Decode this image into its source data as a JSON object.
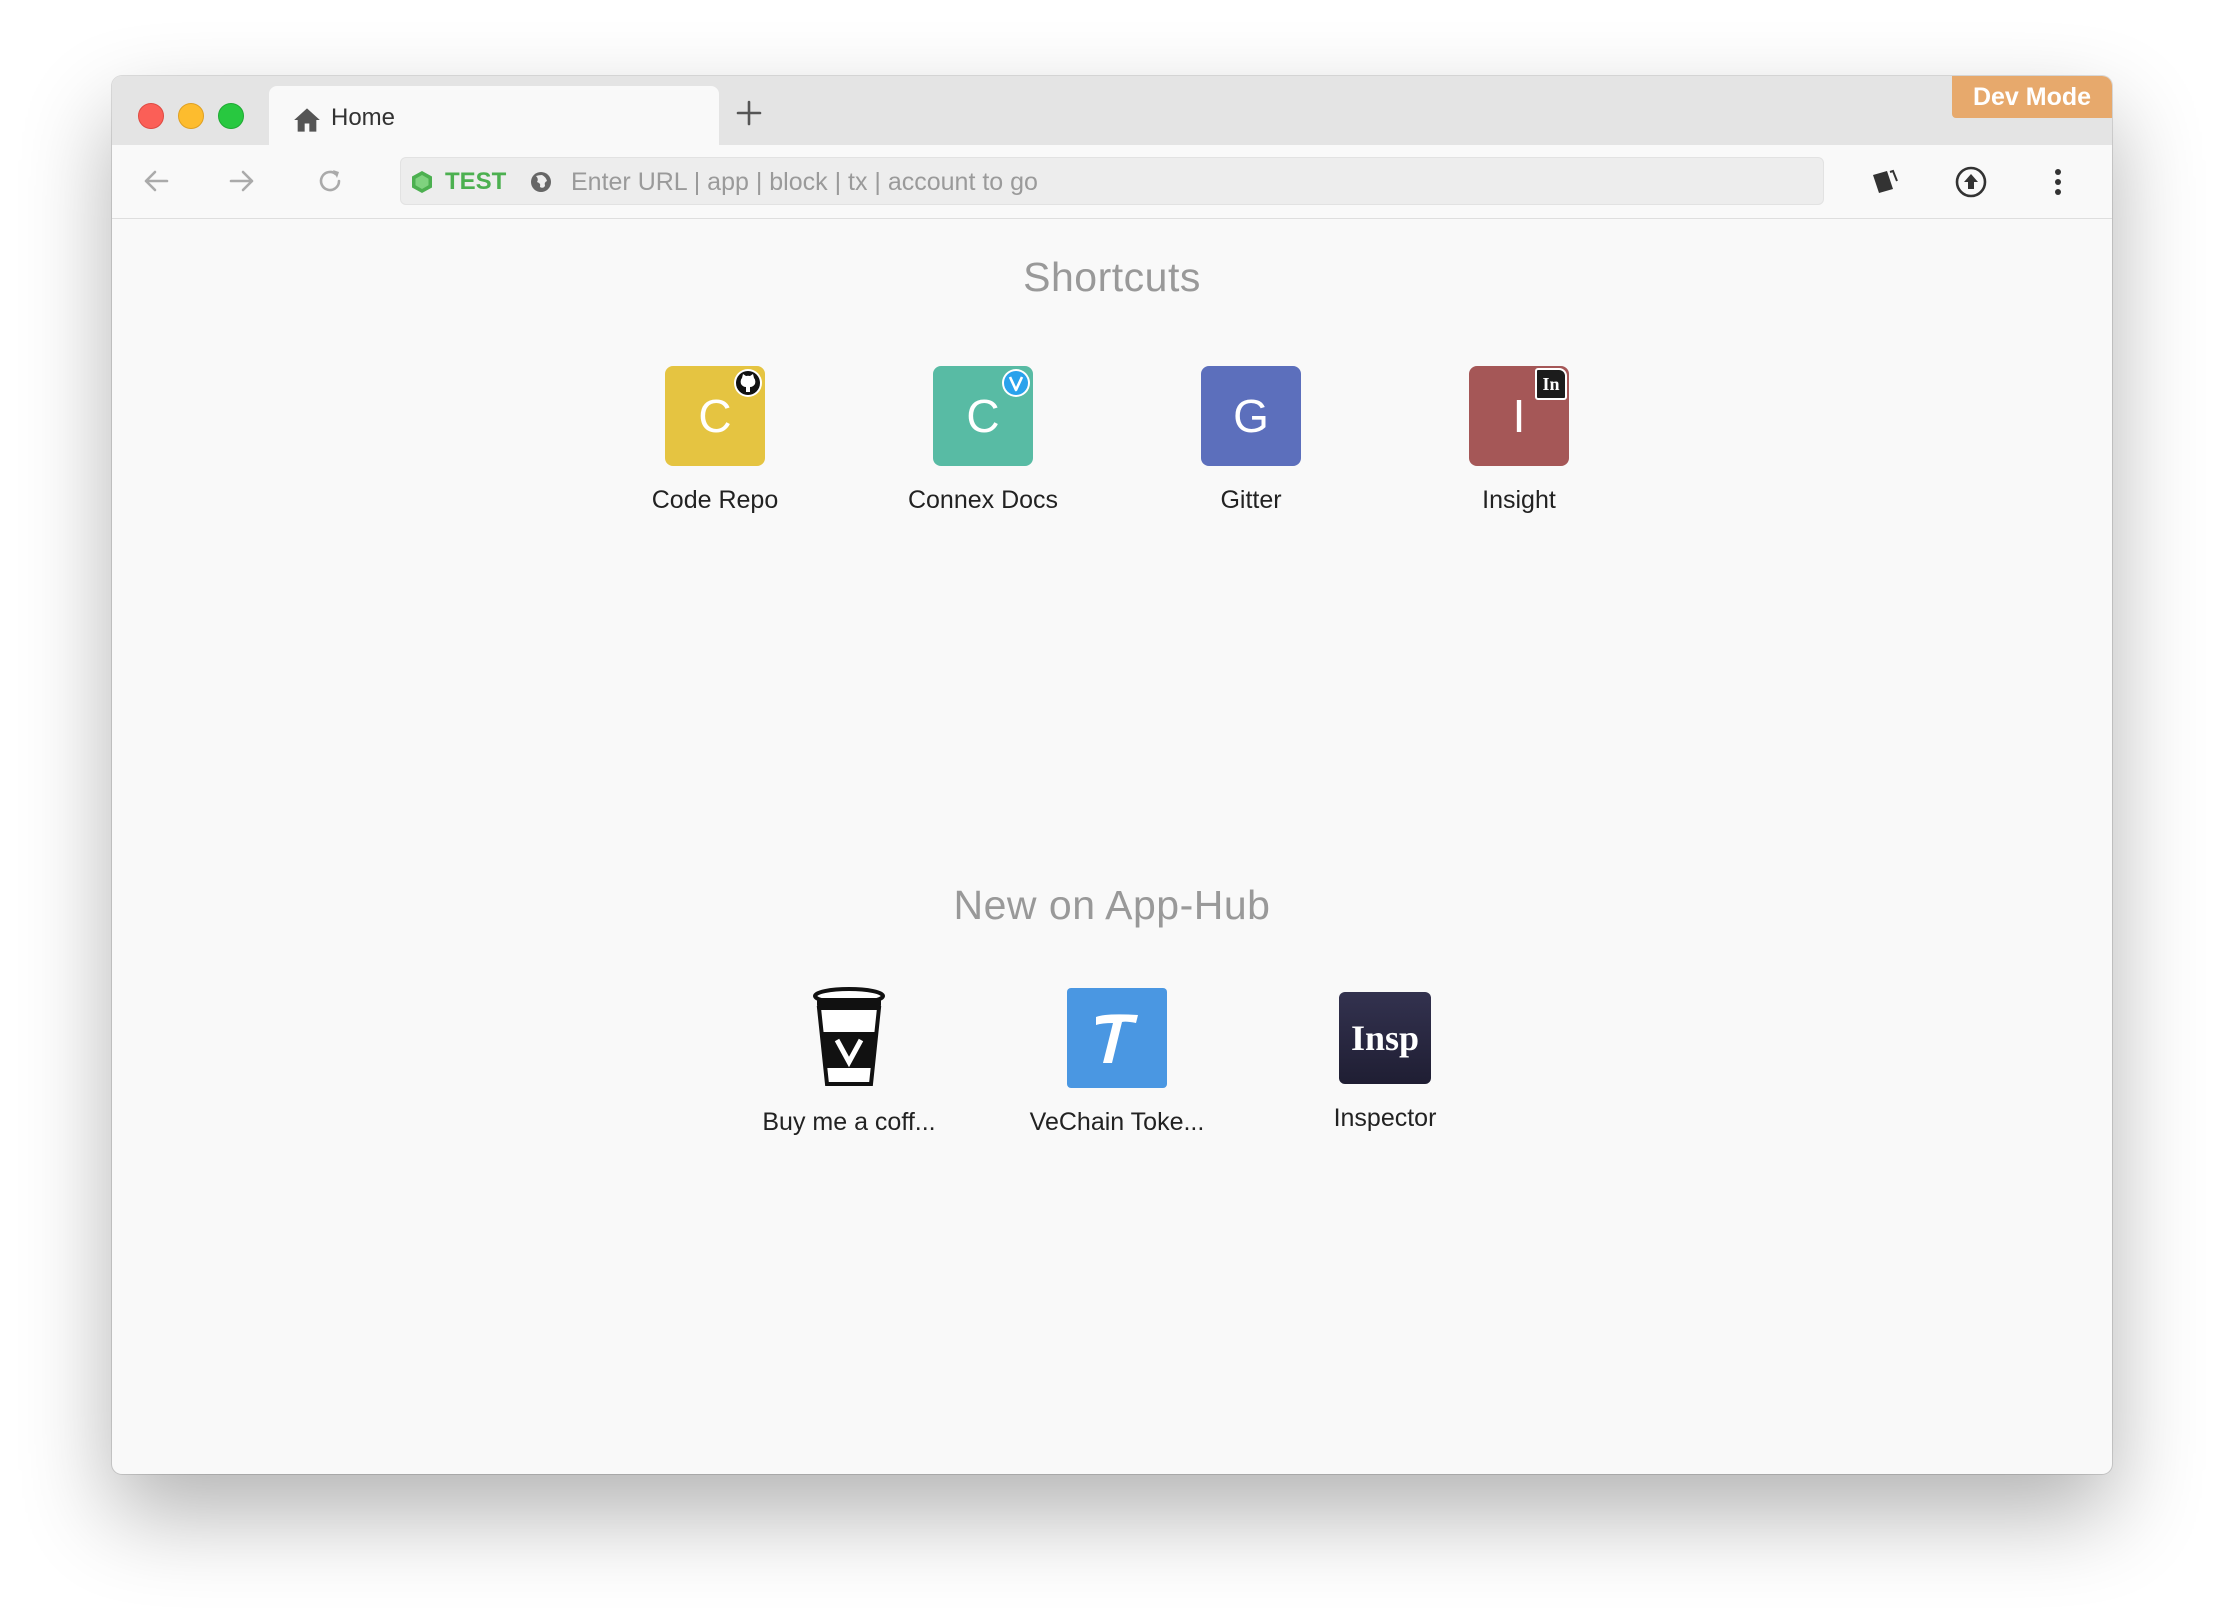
{
  "window": {
    "tab_title": "Home",
    "dev_mode": "Dev Mode"
  },
  "toolbar": {
    "network": "TEST",
    "url_placeholder": "Enter URL | app | block | tx | account to go"
  },
  "shortcuts": {
    "title": "Shortcuts",
    "items": [
      {
        "letter": "C",
        "label": "Code Repo",
        "color": "#e5c441",
        "badge": "github-icon"
      },
      {
        "letter": "C",
        "label": "Connex Docs",
        "color": "#58bba4",
        "badge": "vechain-icon"
      },
      {
        "letter": "G",
        "label": "Gitter",
        "color": "#5c6fbc",
        "badge": ""
      },
      {
        "letter": "I",
        "label": "Insight",
        "color": "#a55757",
        "badge": "In"
      }
    ]
  },
  "apphub": {
    "title": "New on App-Hub",
    "items": [
      {
        "label": "Buy me a coff...",
        "icon": "coffee-cup-icon"
      },
      {
        "label": "VeChain Toke...",
        "icon": "vechain-token-icon",
        "color": "#4a97e2"
      },
      {
        "label": "Inspector",
        "icon_text": "Insp",
        "color": "#2b2a43"
      }
    ]
  }
}
